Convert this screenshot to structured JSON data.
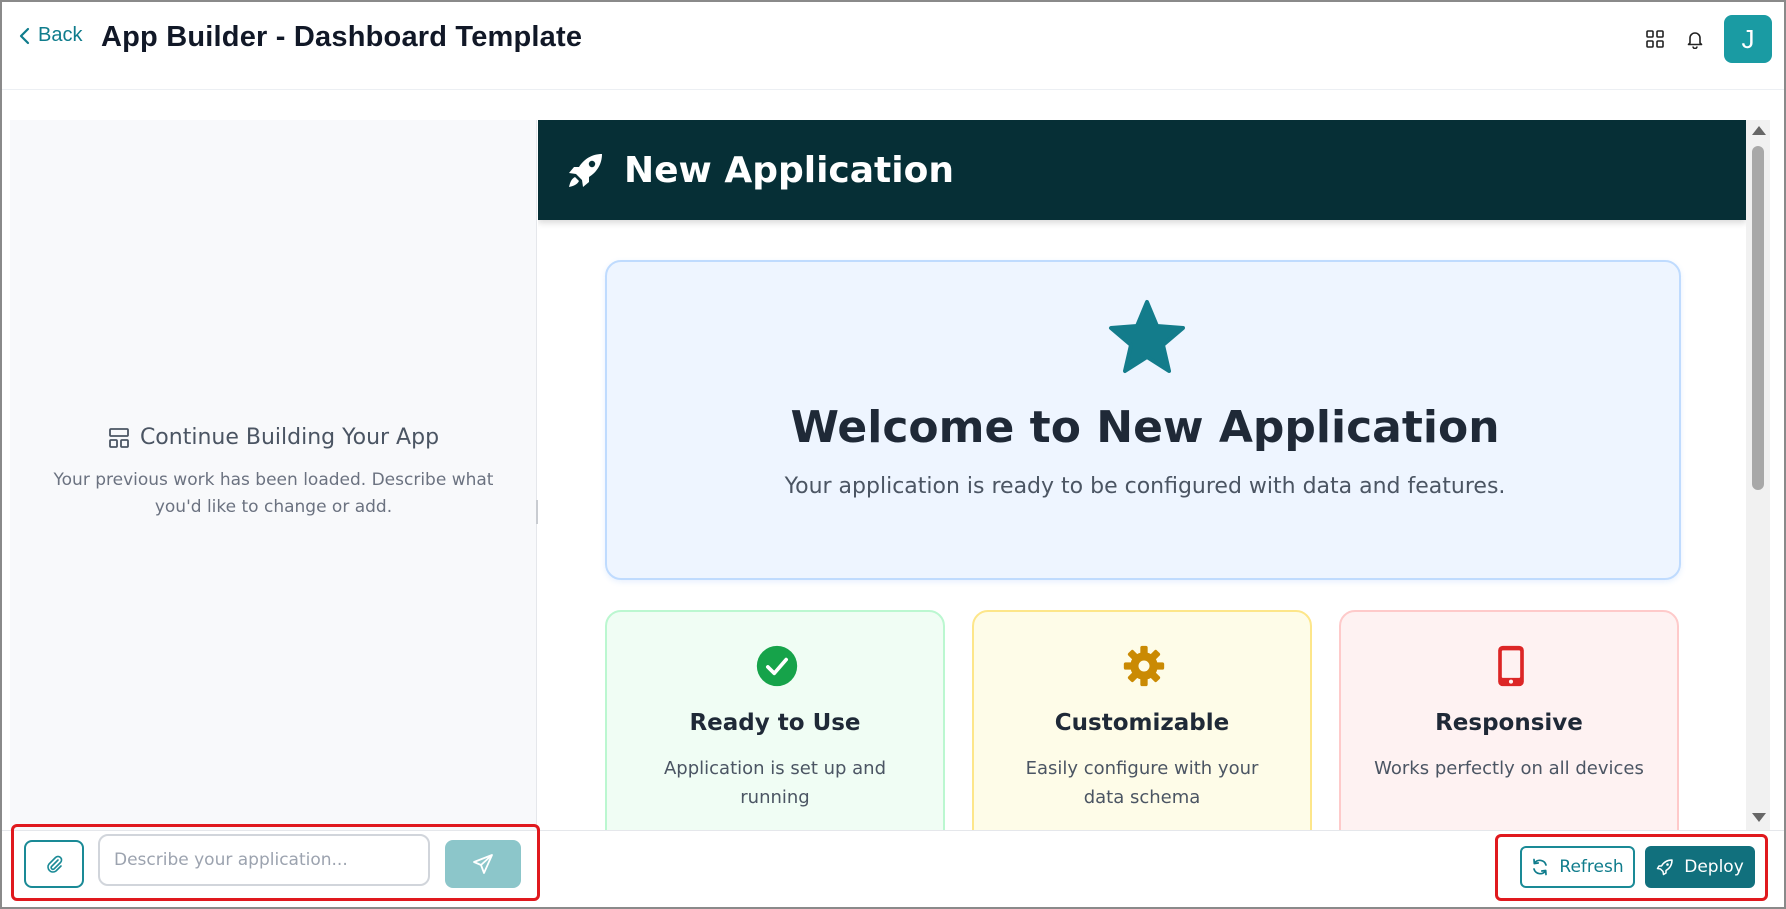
{
  "header": {
    "back_label": "Back",
    "title": "App Builder - Dashboard Template",
    "icons": [
      "grid-icon",
      "bell-icon"
    ],
    "avatar_initial": "J"
  },
  "left_panel": {
    "heading": "Continue Building Your App",
    "description": "Your previous work has been loaded. Describe what you'd like to change or add."
  },
  "preview": {
    "app_bar_title": "New Application",
    "welcome": {
      "title": "Welcome to New Application",
      "subtitle": "Your application is ready to be configured with data and features."
    },
    "features": [
      {
        "title": "Ready to Use",
        "description": "Application is set up and running",
        "icon": "check-circle-icon",
        "color": "#16a34a"
      },
      {
        "title": "Customizable",
        "description": "Easily configure with your data schema",
        "icon": "gear-icon",
        "color": "#ca8a04"
      },
      {
        "title": "Responsive",
        "description": "Works perfectly on all devices",
        "icon": "mobile-icon",
        "color": "#dc2626"
      }
    ]
  },
  "composer": {
    "input_value": "",
    "input_placeholder": "Describe your application..."
  },
  "actions": {
    "refresh_label": "Refresh",
    "deploy_label": "Deploy"
  },
  "colors": {
    "accent": "#1a8a96",
    "app_bar": "#062f36",
    "star": "#137c8b",
    "highlight": "#e0191e"
  }
}
